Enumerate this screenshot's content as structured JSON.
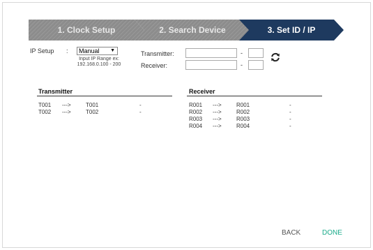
{
  "wizard": {
    "steps": [
      {
        "label": "1. Clock Setup"
      },
      {
        "label": "2. Search Device"
      },
      {
        "label": "3. Set ID / IP"
      }
    ],
    "colors": {
      "inactive": "#8a8a8a",
      "active": "#1e3a5f"
    }
  },
  "ip_setup": {
    "label": "IP Setup",
    "colon": ":",
    "mode": "Manual",
    "hint_line1": "Input IP Range ex:",
    "hint_line2": "192.168.0.100 - 200",
    "transmitter_label": "Transmitter:",
    "receiver_label": "Receiver:",
    "dash": "-",
    "transmitter_start": "",
    "transmitter_end": "",
    "receiver_start": "",
    "receiver_end": "",
    "refresh_icon": "refresh-icon"
  },
  "transmitter_table": {
    "title": "Transmitter",
    "rows": [
      {
        "id": "T001",
        "arrow": "--->",
        "name": "T001",
        "ip": "-"
      },
      {
        "id": "T002",
        "arrow": "--->",
        "name": "T002",
        "ip": "-"
      }
    ]
  },
  "receiver_table": {
    "title": "Receiver",
    "rows": [
      {
        "id": "R001",
        "arrow": "--->",
        "name": "R001",
        "ip": "-"
      },
      {
        "id": "R002",
        "arrow": "--->",
        "name": "R002",
        "ip": "-"
      },
      {
        "id": "R003",
        "arrow": "--->",
        "name": "R003",
        "ip": "-"
      },
      {
        "id": "R004",
        "arrow": "--->",
        "name": "R004",
        "ip": "-"
      }
    ]
  },
  "footer": {
    "back_label": "BACK",
    "done_label": "DONE",
    "done_color": "#1aab8a"
  }
}
